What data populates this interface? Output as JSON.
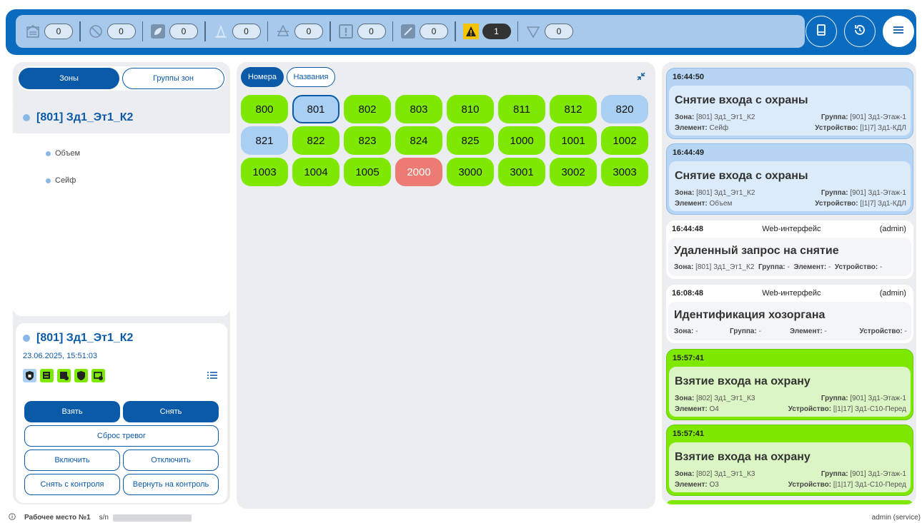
{
  "topbar": {
    "counters": [
      {
        "icon": "fire-station-icon",
        "value": "0"
      },
      {
        "icon": "blocked-icon",
        "value": "0"
      },
      {
        "icon": "leaf-icon",
        "value": "0"
      },
      {
        "icon": "road-icon",
        "value": "0"
      },
      {
        "icon": "dash-warning-icon",
        "value": "0"
      },
      {
        "icon": "exclamation-icon",
        "value": "0"
      },
      {
        "icon": "pen-icon",
        "value": "0"
      },
      {
        "icon": "warning-triangle-icon",
        "value": "1"
      },
      {
        "icon": "down-triangle-icon",
        "value": "0"
      }
    ],
    "buttons": [
      "book-icon",
      "history-icon",
      "menu-icon"
    ]
  },
  "left": {
    "tabs": {
      "zones": "Зоны",
      "zone_groups": "Группы зон"
    },
    "zone_title": "[801] Зд1_Эт1_К2",
    "elements": [
      "Объем",
      "Сейф"
    ],
    "info": {
      "title": "[801] Зд1_Эт1_К2",
      "datetime": "23.06.2025, 15:51:03",
      "buttons": {
        "arm": "Взять",
        "disarm": "Снять",
        "reset": "Сброс тревог",
        "enable": "Включить",
        "disable": "Отключить",
        "uncontrol": "Снять с контроля",
        "return_control": "Вернуть на контроль"
      }
    }
  },
  "middle": {
    "tabs": {
      "numbers": "Номера",
      "names": "Названия"
    },
    "zones": [
      "800",
      "801",
      "802",
      "803",
      "810",
      "811",
      "812",
      "820",
      "821",
      "822",
      "823",
      "824",
      "825",
      "1000",
      "1001",
      "1002",
      "1003",
      "1004",
      "1005",
      "2000",
      "3000",
      "3001",
      "3002",
      "3003"
    ],
    "zone_states": [
      "green",
      "blue-selected",
      "green",
      "green",
      "green",
      "green",
      "green",
      "blue",
      "blue",
      "green",
      "green",
      "green",
      "green",
      "green",
      "green",
      "green",
      "green",
      "green",
      "green",
      "red",
      "green",
      "green",
      "green",
      "green"
    ]
  },
  "events": [
    {
      "time": "16:44:50",
      "title": "Снятие входа с охраны",
      "zone": "[801] Зд1_Эт1_К2",
      "group": "[901] Зд1-Этаж-1",
      "element": "Сейф",
      "device": "[|1|7] Зд1-КДЛ"
    },
    {
      "time": "16:44:49",
      "title": "Снятие входа с охраны",
      "zone": "[801] Зд1_Эт1_К2",
      "group": "[901] Зд1-Этаж-1",
      "element": "Объем",
      "device": "[|1|7] Зд1-КДЛ"
    },
    {
      "time": "16:44:48",
      "source": "Web-интерфейс",
      "user": "(admin)",
      "title": "Удаленный запрос на снятие",
      "zone": "[801] Зд1_Эт1_К2",
      "group": "-",
      "element": "-",
      "device": "-"
    },
    {
      "time": "16:08:48",
      "source": "Web-интерфейс",
      "user": "(admin)",
      "title": "Идентификация хозоргана",
      "zone": "-",
      "group": "-",
      "element": "-",
      "device": "-"
    },
    {
      "time": "15:57:41",
      "title": "Взятие входа на охрану",
      "zone": "[802] Зд1_Эт1_К3",
      "group": "[901] Зд1-Этаж-1",
      "element": "О4",
      "device": "[|1|17] Зд1-С10-Перед"
    },
    {
      "time": "15:57:41",
      "title": "Взятие входа на охрану",
      "zone": "[802] Зд1_Эт1_К3",
      "group": "[901] Зд1-Этаж-1",
      "element": "О3",
      "device": "[|1|17] Зд1-С10-Перед"
    }
  ],
  "labels": {
    "zone": "Зона:",
    "group": "Группа:",
    "element": "Элемент:",
    "device": "Устройство:"
  },
  "status": {
    "workstation": "Рабочее место №1",
    "sn_label": "s/n",
    "user": "admin (service)"
  },
  "colors": {
    "primary": "#0b5aa8",
    "zone_green": "#7ee800",
    "zone_blue": "#a9cff3",
    "zone_red": "#ec7b73"
  }
}
